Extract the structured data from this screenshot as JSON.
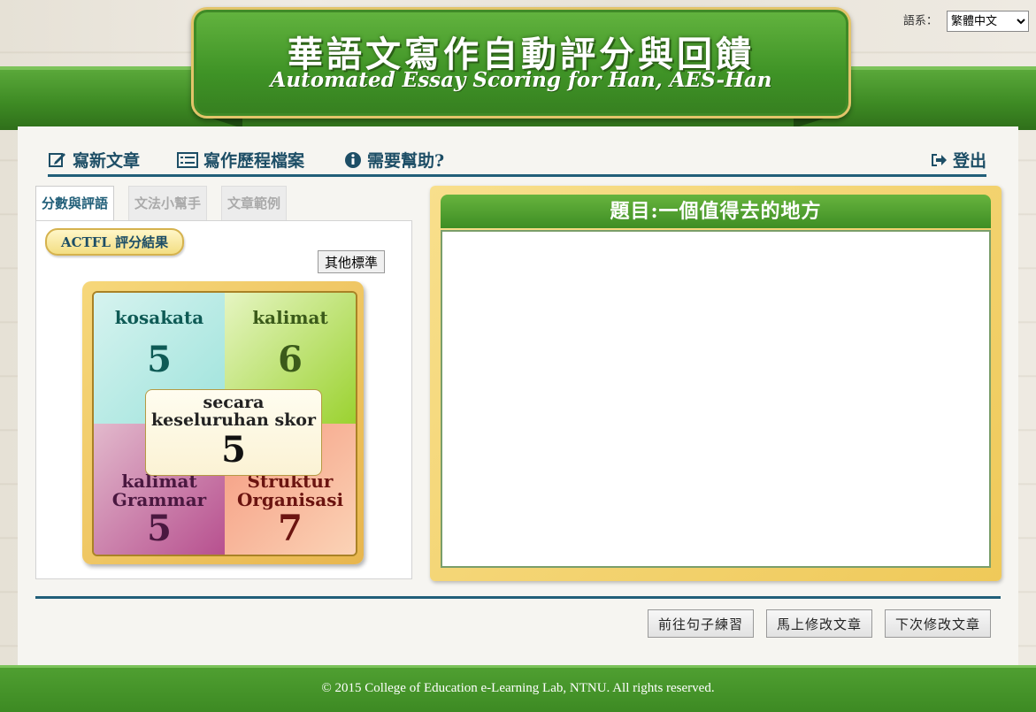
{
  "header": {
    "title": "華語文寫作自動評分與回饋",
    "subtitle": "Automated Essay Scoring for Han, AES-Han"
  },
  "language": {
    "label": "語系：",
    "selected": "繁體中文"
  },
  "nav": {
    "write_new": "寫新文章",
    "history": "寫作歷程檔案",
    "help": "需要幫助?",
    "logout": "登出"
  },
  "tabs": [
    "分數與評語",
    "文法小幫手",
    "文章範例"
  ],
  "score_panel": {
    "actfl_label": "ACTFL 評分結果",
    "other_standard": "其他標準",
    "quadrants": [
      {
        "label": "kosakata",
        "value": "5"
      },
      {
        "label": "kalimat",
        "value": "6"
      },
      {
        "label": "kalimat Grammar",
        "value": "5"
      },
      {
        "label": "Struktur Organisasi",
        "value": "7"
      }
    ],
    "overall": {
      "label": "secara keseluruhan skor",
      "value": "5"
    }
  },
  "topic": {
    "title": "題目:一個值得去的地方",
    "essay_text": ""
  },
  "actions": {
    "sentence_practice": "前往句子練習",
    "edit_now": "馬上修改文章",
    "edit_later": "下次修改文章"
  },
  "footer": {
    "copyright": "© 2015 College of Education e-Learning Lab, NTNU. All rights reserved."
  },
  "colors": {
    "nav_blue": "#215f79",
    "brand_green": "#4f9f31",
    "gold": "#efc959"
  }
}
